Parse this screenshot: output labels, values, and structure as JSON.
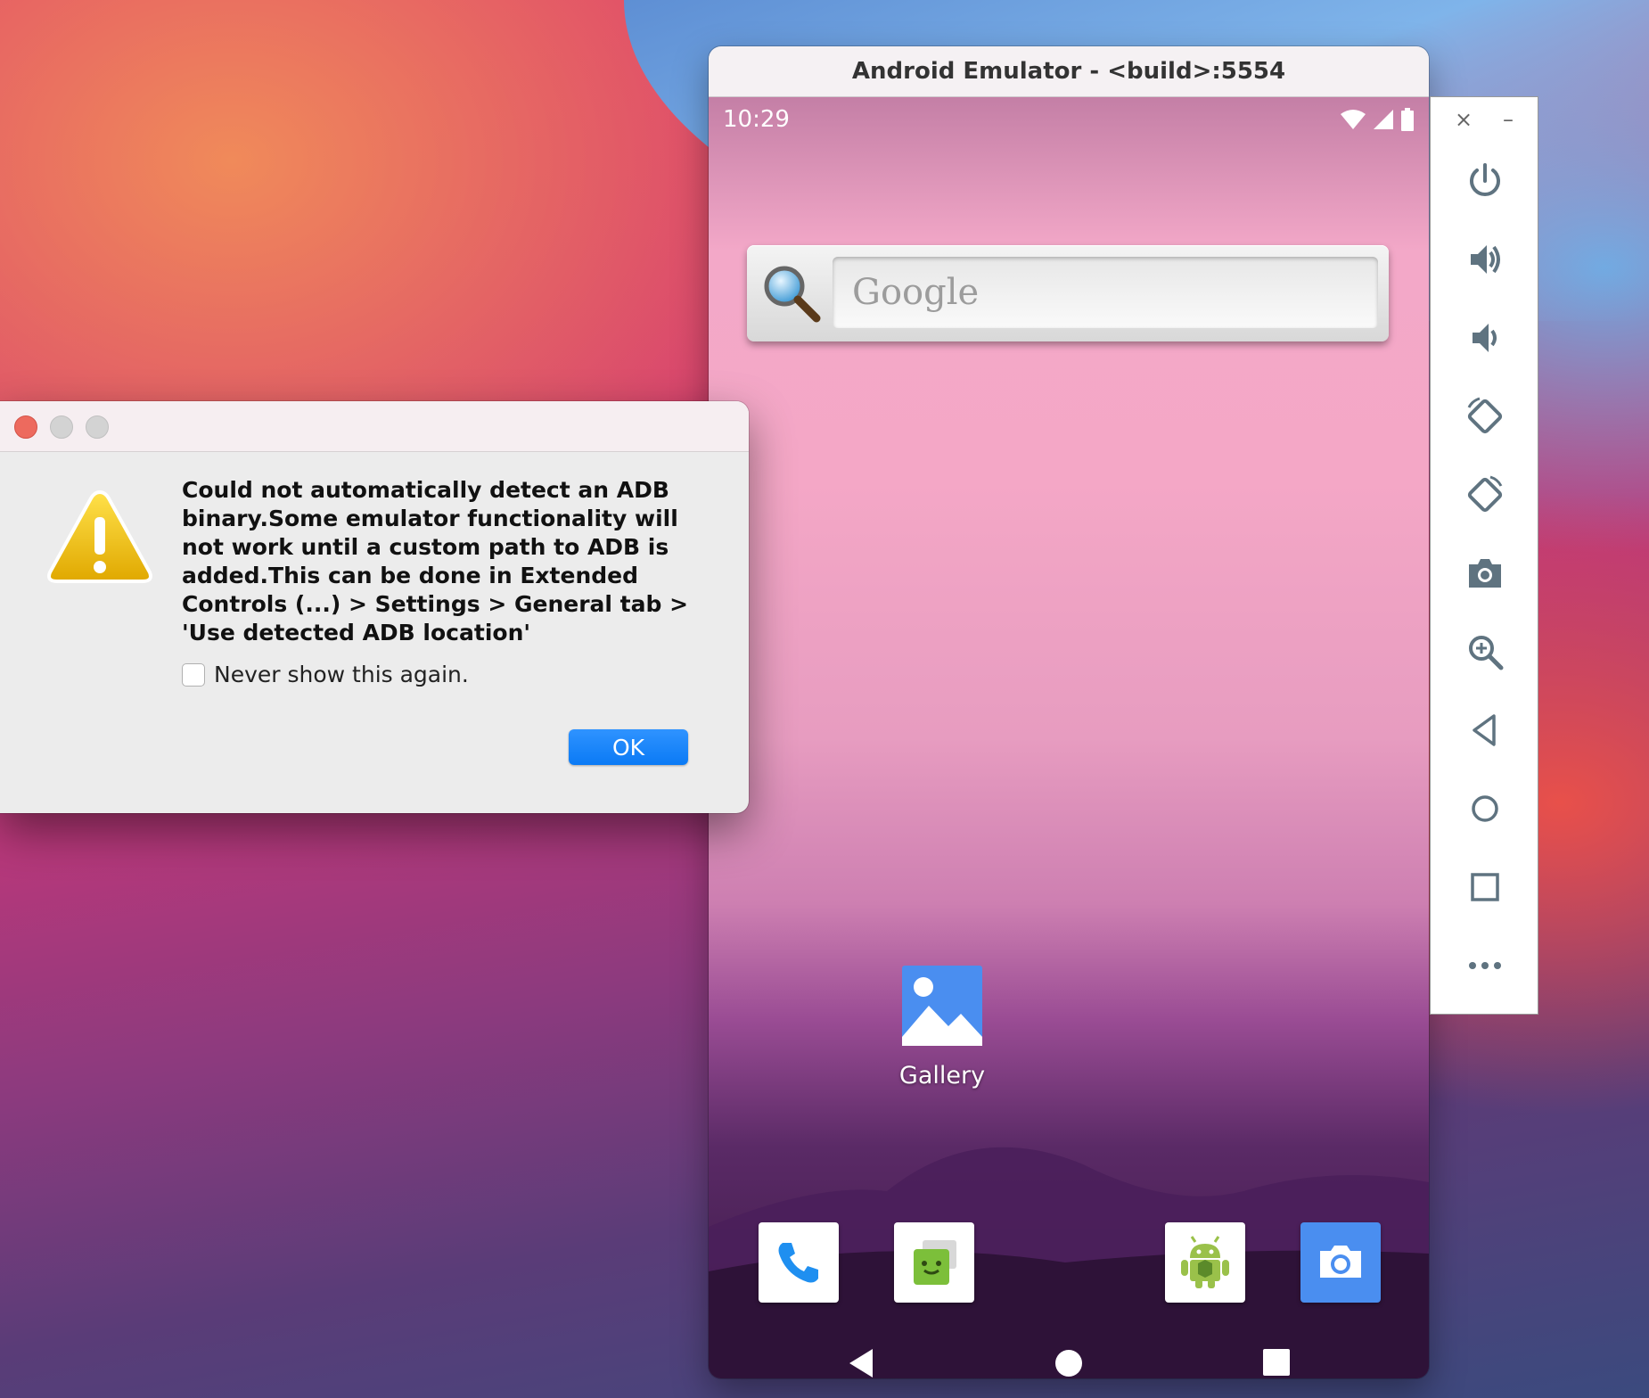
{
  "desktop": {
    "wallpaper": "macOS Big Sur gradient"
  },
  "emulator": {
    "title": "Android Emulator - <build>:5554",
    "status_bar": {
      "time": "10:29",
      "icons": [
        "wifi-icon",
        "signal-icon",
        "battery-icon"
      ]
    },
    "search_widget": {
      "placeholder": "Google"
    },
    "home_apps": [
      {
        "label": "Gallery",
        "icon": "gallery-icon"
      }
    ],
    "dock": [
      "phone-icon",
      "messaging-icon",
      "android-app-icon",
      "camera-icon"
    ],
    "navbar": [
      "back-icon",
      "home-icon",
      "recents-icon"
    ],
    "toolbar": {
      "top": {
        "close": "×",
        "minimize": "–"
      },
      "buttons": [
        "power-icon",
        "volume-up-icon",
        "volume-down-icon",
        "rotate-left-icon",
        "rotate-right-icon",
        "screenshot-icon",
        "zoom-icon",
        "back-icon",
        "home-icon",
        "overview-icon",
        "more-icon"
      ]
    }
  },
  "dialog": {
    "message": "Could not automatically detect an ADB binary.Some emulator functionality will not work until a custom path to ADB  is added.This can be done in Extended Controls (...) > Settings > General tab > 'Use detected ADB location'",
    "checkbox_label": "Never show this again.",
    "checkbox_checked": false,
    "ok_label": "OK",
    "colors": {
      "ok_button": "#0a7af5",
      "close_light": "#ed6a5e",
      "inactive_light": "#d3d3d3"
    }
  }
}
